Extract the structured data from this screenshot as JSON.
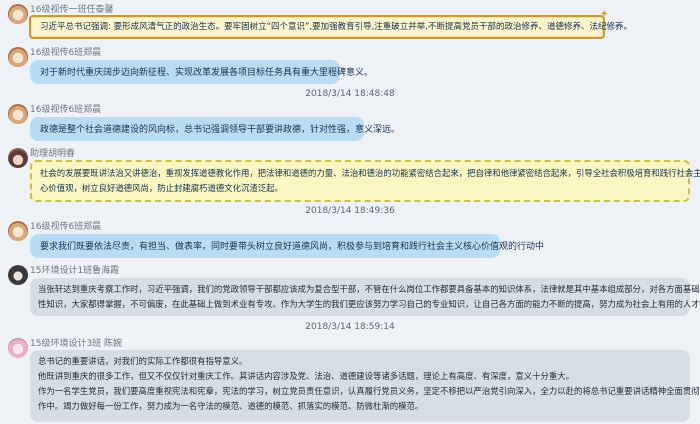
{
  "messages": [
    {
      "sender": "16级视传一班任泰馨",
      "lines": [
        "习近平总书记强调: 要形成风清气正的政治生态。要牢固树立“四个意识”,要加强教育引导,注重破立并举,不断提高党员干部的政治修养、道德修养、法纪修养。"
      ],
      "style": "gold-border"
    },
    {
      "sender": "16级视传6班郑晨",
      "lines": [
        "对于新时代重庆阔步迈向新征程、实现改革发展各项目标任务具有重大里程碑意义。"
      ],
      "style": "blue"
    },
    {
      "sender": "16级视传6班郑晨",
      "lines": [
        "政德是整个社会道德建设的风向标，总书记强调领导干部要讲政德，针对性强，意义深远。"
      ],
      "style": "blue"
    },
    {
      "sender": "助理胡明春",
      "lines": [
        "社会的发展要既讲法治又讲德治，重视发挥道德教化作用，把法律和道德的力量、法治和德治的功能紧密结合起来，把自律和他律紧密结合起来，引导全社会积极培育和践行社会主义核",
        "心价值观，树立良好道德风尚，防止封建腐朽道德文化沉渣泛起。"
      ],
      "style": "yellow-border"
    },
    {
      "sender": "16级视传6班郑晨",
      "lines": [
        "要求我们既要依法尽责，有担当、做表率，同时要带头树立良好道德风尚，积极参与到培育和践行社会主义核心价值观的行动中"
      ],
      "style": "blue"
    },
    {
      "sender": "15环境设计1班鲁海霞",
      "lines": [
        "当张轩达到重庆考察工作时，习近平强调，我们的党政领导干部都应该成为复合型干部，不管在什么岗位工作都要具备基本的知识体系，法律就是其中基本组成部分，对各方面基础",
        "性知识，大家都得掌握，不可偏废，在此基础上做到术业有专攻。作为大学生的我们更应该努力学习自己的专业知识，让自己各方面的能力不断的提高，努力成为社会上有用的人才。"
      ],
      "style": "gray"
    },
    {
      "sender": "15级环境设计3班 陈婉",
      "lines": [
        "总书记的重要讲话，对我们的实际工作都很有指导意义。",
        "他既讲到重庆的很多工作，但又不仅仅针对重庆工作。其讲话内容涉及党、法治、道德建设等诸多话题，理论上有高度、有深度，意义十分重大。",
        "作为一名学生党员，我们要高度重视宪法和宪章，宪法的学习，树立党员责任意识，认真履行党员义务，坚定不移把以严治党引向深入，全力以赴的将总书记重要讲话精神全面贯彻到各项工",
        "作中。竭力做好每一份工作，努力成为一名守法的模范、道德的模范、抓落实的模范、防微杜渐的模范。"
      ],
      "style": "gray"
    }
  ],
  "timestamps": [
    "2018/3/14 18:48:48",
    "2018/3/14 18:49:36",
    "2018/3/14 18:59:14"
  ],
  "colors": {
    "background": "#eef1f6",
    "blue_bubble": "#b9dcf6",
    "gray_bubble": "#d6dde6",
    "gold_border": "#c79a3c",
    "yellow_bubble": "#f9f6c2",
    "name_text": "#6d7783"
  }
}
